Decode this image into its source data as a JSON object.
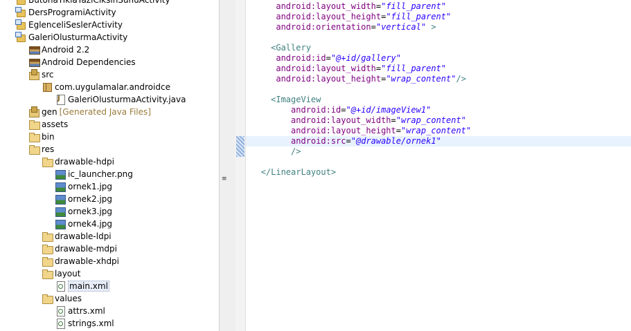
{
  "tree": {
    "items": [
      {
        "label": "ButonaTiklaYaziCiksinSunuActivity",
        "icon": "project-icon",
        "indent": 0
      },
      {
        "label": "DersProgramiActivity",
        "icon": "project-icon",
        "indent": 0
      },
      {
        "label": "EglenceliSeslerActivity",
        "icon": "project-icon",
        "indent": 0
      },
      {
        "label": "GaleriOlusturmaActivity",
        "icon": "project-icon",
        "indent": 0
      },
      {
        "label": "Android 2.2",
        "icon": "library-icon",
        "indent": 1
      },
      {
        "label": "Android Dependencies",
        "icon": "library-icon",
        "indent": 1
      },
      {
        "label": "src",
        "icon": "source-folder-icon",
        "indent": 1
      },
      {
        "label": "com.uygulamalar.androidce",
        "icon": "package-icon",
        "indent": 2
      },
      {
        "label": "GaleriOlusturmaActivity.java",
        "icon": "java-file-icon",
        "indent": 3
      },
      {
        "label": "gen",
        "decor": "[Generated Java Files]",
        "icon": "source-folder-icon",
        "indent": 1
      },
      {
        "label": "assets",
        "icon": "folder-icon",
        "indent": 1
      },
      {
        "label": "bin",
        "icon": "folder-icon",
        "indent": 1
      },
      {
        "label": "res",
        "icon": "folder-icon",
        "indent": 1
      },
      {
        "label": "drawable-hdpi",
        "icon": "folder-icon",
        "indent": 2
      },
      {
        "label": "ic_launcher.png",
        "icon": "image-file-icon",
        "indent": 3
      },
      {
        "label": "ornek1.jpg",
        "icon": "image-file-icon",
        "indent": 3
      },
      {
        "label": "ornek2.jpg",
        "icon": "image-file-icon",
        "indent": 3
      },
      {
        "label": "ornek3.jpg",
        "icon": "image-file-icon",
        "indent": 3
      },
      {
        "label": "ornek4.jpg",
        "icon": "image-file-icon",
        "indent": 3
      },
      {
        "label": "drawable-ldpi",
        "icon": "folder-icon",
        "indent": 2
      },
      {
        "label": "drawable-mdpi",
        "icon": "folder-icon",
        "indent": 2
      },
      {
        "label": "drawable-xhdpi",
        "icon": "folder-icon",
        "indent": 2
      },
      {
        "label": "layout",
        "icon": "folder-icon",
        "indent": 2
      },
      {
        "label": "main.xml",
        "icon": "xml-file-icon",
        "indent": 3,
        "selected": true
      },
      {
        "label": "values",
        "icon": "folder-icon",
        "indent": 2
      },
      {
        "label": "attrs.xml",
        "icon": "xml-file-icon",
        "indent": 3
      },
      {
        "label": "strings.xml",
        "icon": "xml-file-icon",
        "indent": 3
      }
    ]
  },
  "sash": {
    "handle": "≡"
  },
  "editor": {
    "lines": [
      {
        "indent": "   ",
        "tokens": [
          [
            "attr",
            "android:layout_width"
          ],
          [
            "plain",
            "="
          ],
          [
            "val",
            "\"fill_parent\""
          ]
        ]
      },
      {
        "indent": "   ",
        "tokens": [
          [
            "attr",
            "android:layout_height"
          ],
          [
            "plain",
            "="
          ],
          [
            "val",
            "\"fill_parent\""
          ]
        ]
      },
      {
        "indent": "   ",
        "tokens": [
          [
            "attr",
            "android:orientation"
          ],
          [
            "plain",
            "="
          ],
          [
            "val",
            "\"vertical\""
          ],
          [
            "tag",
            " >"
          ]
        ]
      },
      {
        "indent": "",
        "tokens": []
      },
      {
        "indent": "  ",
        "tokens": [
          [
            "tag",
            "<Gallery"
          ]
        ]
      },
      {
        "indent": "   ",
        "tokens": [
          [
            "attr",
            "android:id"
          ],
          [
            "plain",
            "="
          ],
          [
            "val",
            "\"@+id/gallery\""
          ]
        ]
      },
      {
        "indent": "   ",
        "tokens": [
          [
            "attr",
            "android:layout_width"
          ],
          [
            "plain",
            "="
          ],
          [
            "val",
            "\"fill_parent\""
          ]
        ]
      },
      {
        "indent": "   ",
        "tokens": [
          [
            "attr",
            "android:layout_height"
          ],
          [
            "plain",
            "="
          ],
          [
            "val",
            "\"wrap_content\""
          ],
          [
            "tag",
            "/>"
          ]
        ]
      },
      {
        "indent": "",
        "tokens": []
      },
      {
        "indent": "  ",
        "tokens": [
          [
            "tag",
            "<ImageView"
          ]
        ]
      },
      {
        "indent": "      ",
        "tokens": [
          [
            "attr",
            "android:id"
          ],
          [
            "plain",
            "="
          ],
          [
            "val",
            "\"@+id/imageView1\""
          ]
        ]
      },
      {
        "indent": "      ",
        "tokens": [
          [
            "attr",
            "android:layout_width"
          ],
          [
            "plain",
            "="
          ],
          [
            "val",
            "\"wrap_content\""
          ]
        ]
      },
      {
        "indent": "      ",
        "tokens": [
          [
            "attr",
            "android:layout_height"
          ],
          [
            "plain",
            "="
          ],
          [
            "val",
            "\"wrap_content\""
          ]
        ]
      },
      {
        "indent": "      ",
        "tokens": [
          [
            "attr",
            "android:src"
          ],
          [
            "plain",
            "="
          ],
          [
            "val",
            "\"@drawable/ornek1\""
          ]
        ],
        "current": true
      },
      {
        "indent": "      ",
        "tokens": [
          [
            "tag",
            "/>"
          ]
        ]
      },
      {
        "indent": "",
        "tokens": []
      },
      {
        "indent": "",
        "tokens": [
          [
            "tag",
            "</LinearLayout>"
          ]
        ]
      }
    ]
  }
}
